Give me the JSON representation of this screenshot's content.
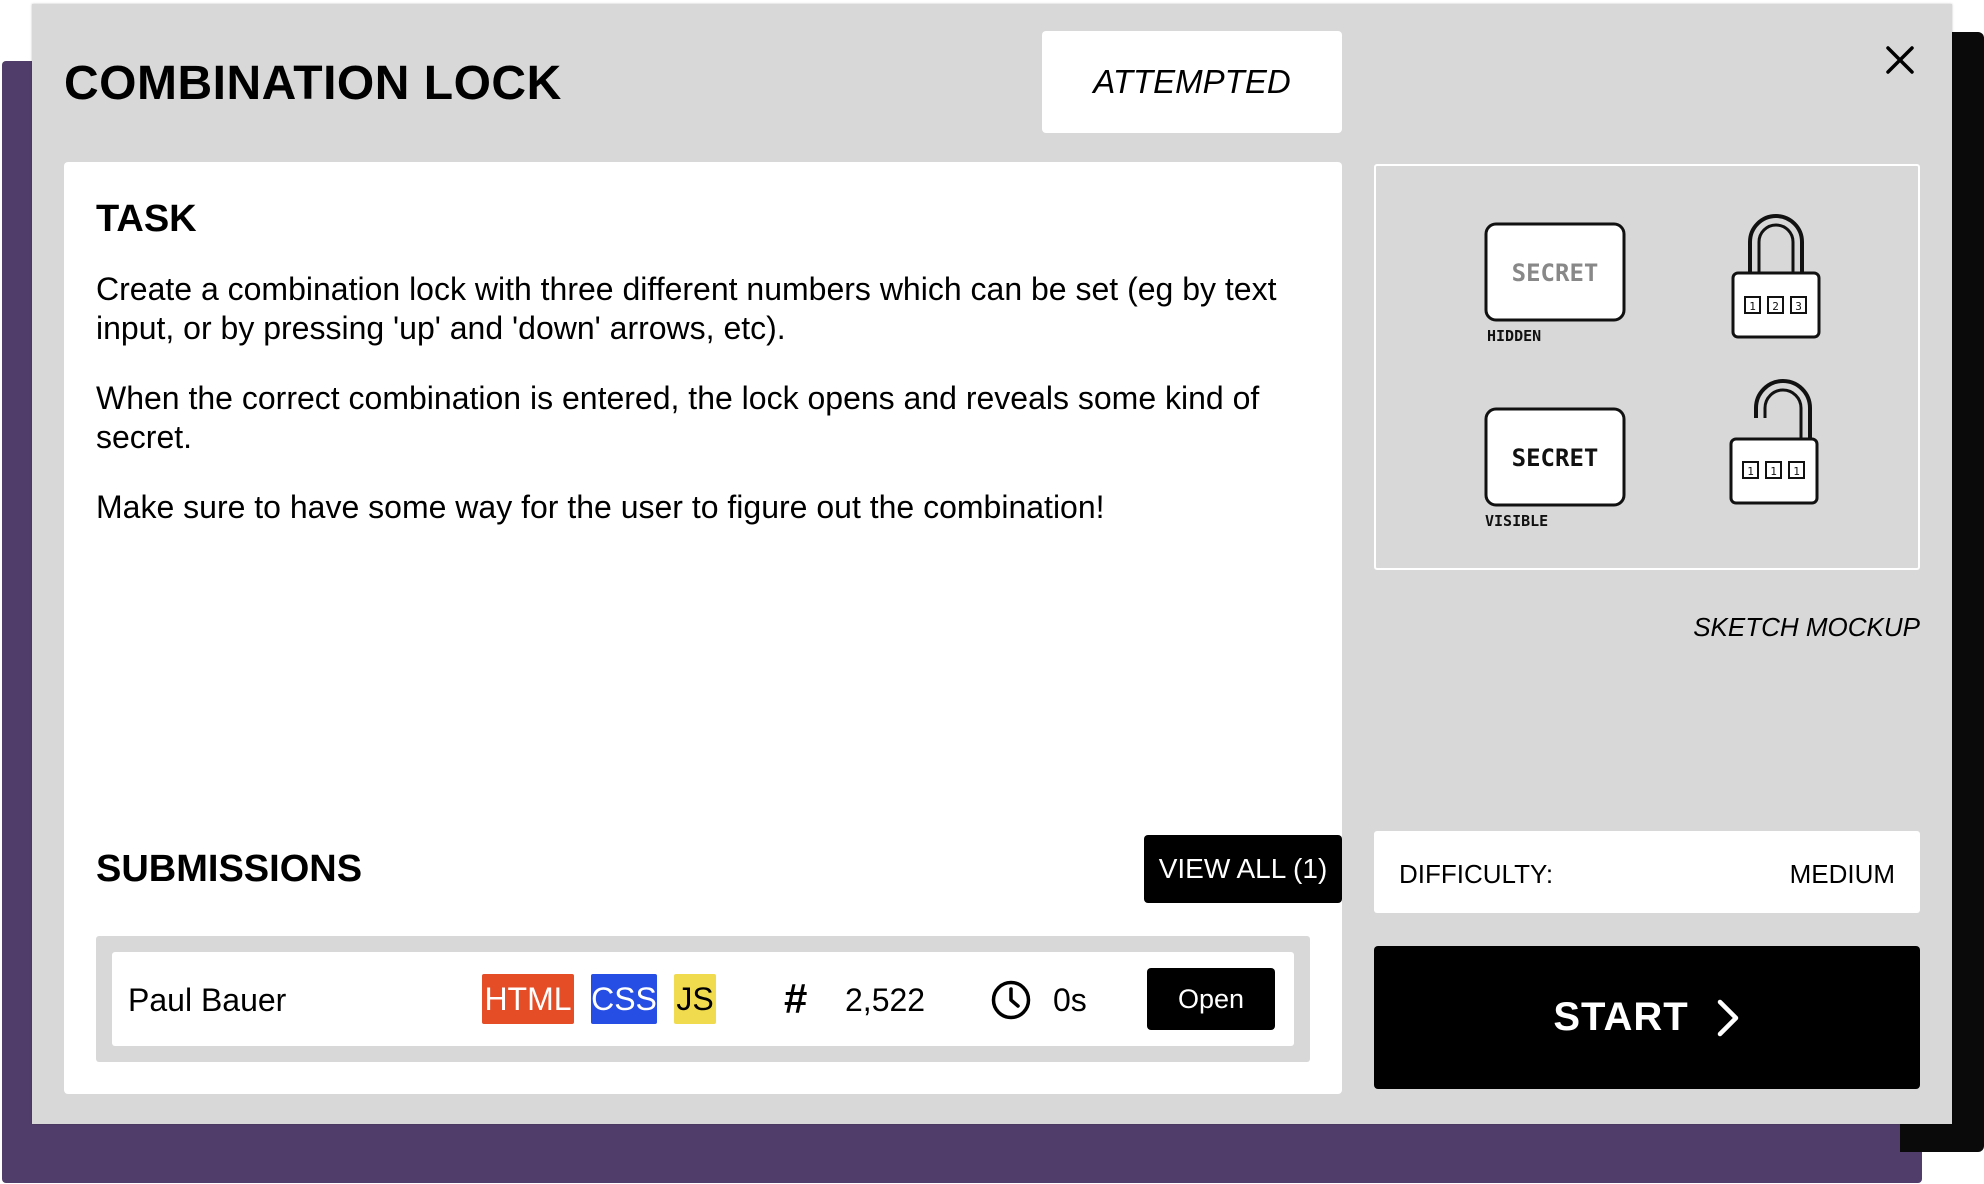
{
  "challenge": {
    "title": "COMBINATION LOCK",
    "status": "ATTEMPTED"
  },
  "task": {
    "heading": "TASK",
    "paragraphs": [
      "Create a combination lock with three different numbers which can be set (eg by text input, or by pressing 'up' and 'down' arrows, etc).",
      "When the correct combination is entered, the lock opens and reveals some kind of secret.",
      "Make sure to have some way for the user to figure out the combination!"
    ]
  },
  "submissions": {
    "heading": "SUBMISSIONS",
    "view_all_label": "VIEW ALL (1)",
    "items": [
      {
        "author": "Paul Bauer",
        "tags": [
          "HTML",
          "CSS",
          "JS"
        ],
        "views": "2,522",
        "duration": "0s",
        "open_label": "Open"
      }
    ]
  },
  "sketch": {
    "caption": "SKETCH MOCKUP",
    "panel_top": {
      "box_text": "SECRET",
      "label": "HIDDEN",
      "digits": [
        "1",
        "2",
        "3"
      ]
    },
    "panel_bottom": {
      "box_text": "SECRET",
      "label": "VISIBLE",
      "digits": [
        "1",
        "1",
        "1"
      ]
    }
  },
  "difficulty": {
    "label": "DIFFICULTY:",
    "value": "MEDIUM"
  },
  "start": {
    "label": "START"
  },
  "colors": {
    "modal_bg": "#d8d8d8",
    "backdrop_purple": "#513d6a",
    "html_badge": "#e44d26",
    "css_badge": "#264de4",
    "js_badge": "#f0db4f"
  },
  "icons": {
    "close": "close-icon",
    "views": "hash-icon",
    "duration": "clock-icon",
    "start": "chevron-right-icon"
  }
}
